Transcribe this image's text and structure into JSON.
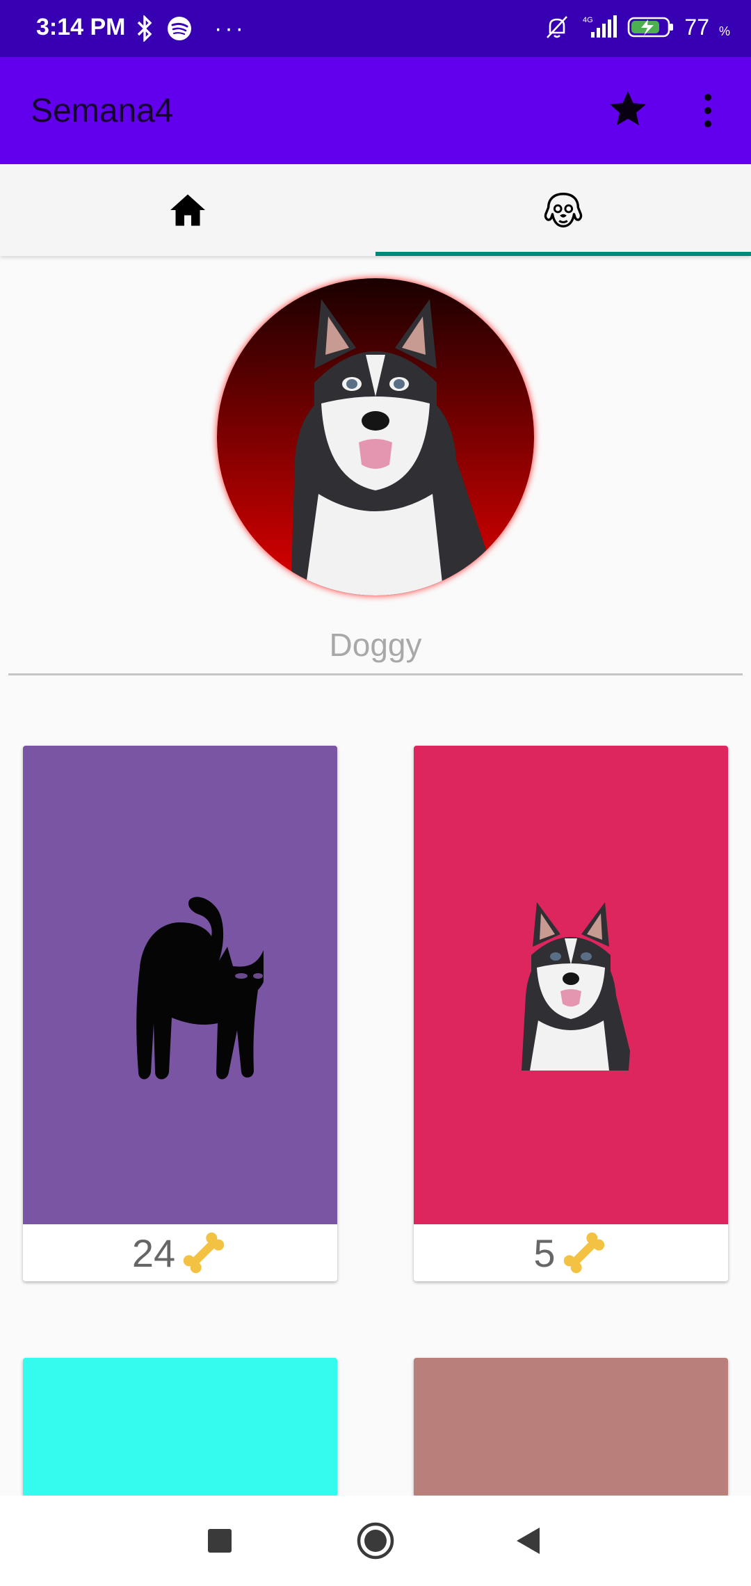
{
  "status_bar": {
    "time": "3:14 PM",
    "more_indicator": "···",
    "battery_level": "77",
    "battery_unit": "%",
    "icons": [
      "bluetooth-icon",
      "spotify-icon",
      "notifications-muted-icon",
      "signal-4g-icon",
      "battery-charging-icon"
    ]
  },
  "app_bar": {
    "title": "Semana4",
    "actions": [
      "star-icon",
      "more-vert-icon"
    ]
  },
  "tabs": [
    {
      "icon": "home-icon",
      "selected": false
    },
    {
      "icon": "dog-face-icon",
      "selected": true
    }
  ],
  "colors": {
    "status_bar": "#3700b3",
    "app_bar": "#6200ee",
    "tab_indicator": "#00897b",
    "card_purple": "#7955a3",
    "card_pink": "#de265e",
    "card_cyan": "#35fbef",
    "card_rose": "#b9807b"
  },
  "profile": {
    "name": "Doggy",
    "avatar": "husky-avatar"
  },
  "pets": [
    {
      "image": "black-cat-icon",
      "likes": "24",
      "like_icon": "bone-icon",
      "background": "#7955a3"
    },
    {
      "image": "husky-icon",
      "likes": "5",
      "like_icon": "bone-icon",
      "background": "#de265e"
    },
    {
      "image": "",
      "background": "#35fbef"
    },
    {
      "image": "",
      "background": "#b9807b"
    }
  ],
  "nav_bar": {
    "buttons": [
      "recent-apps-icon",
      "home-circle-icon",
      "back-icon"
    ]
  }
}
